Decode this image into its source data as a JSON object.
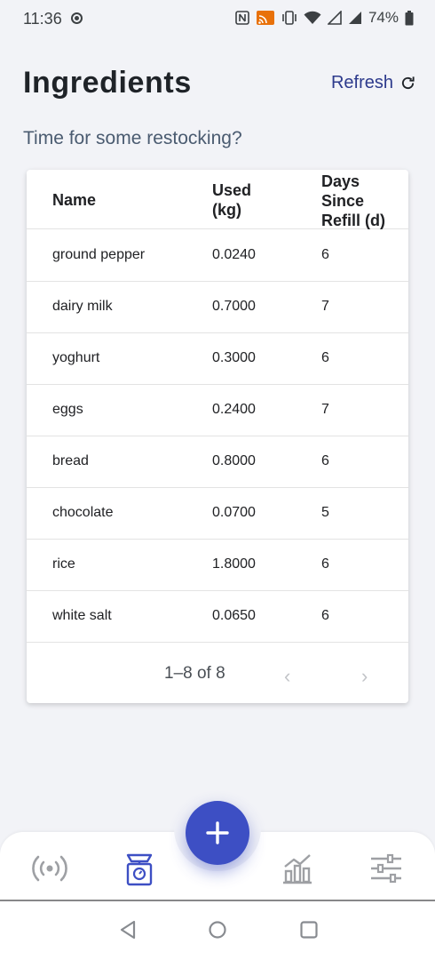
{
  "status_bar": {
    "time": "11:36",
    "battery": "74%",
    "icons": [
      "recording-icon",
      "nfc-icon",
      "cast-icon",
      "vibrate-icon",
      "wifi-icon",
      "signal-icon",
      "signal-icon",
      "battery-icon"
    ]
  },
  "header": {
    "title": "Ingredients",
    "refresh_label": "Refresh"
  },
  "subtitle": "Time for some restocking?",
  "table": {
    "columns": [
      {
        "label": "Name"
      },
      {
        "label": "Used (kg)"
      },
      {
        "label": "Days Since Refill (d)"
      }
    ],
    "rows": [
      {
        "name": "ground pepper",
        "used": "0.0240",
        "days": "6"
      },
      {
        "name": "dairy milk",
        "used": "0.7000",
        "days": "7"
      },
      {
        "name": "yoghurt",
        "used": "0.3000",
        "days": "6"
      },
      {
        "name": "eggs",
        "used": "0.2400",
        "days": "7"
      },
      {
        "name": "bread",
        "used": "0.8000",
        "days": "6"
      },
      {
        "name": "chocolate",
        "used": "0.0700",
        "days": "5"
      },
      {
        "name": "rice",
        "used": "1.8000",
        "days": "6"
      },
      {
        "name": "white salt",
        "used": "0.0650",
        "days": "6"
      }
    ],
    "pagination": "1–8 of 8"
  },
  "bottom_nav": {
    "items": [
      "sensor-icon",
      "scale-icon",
      "chart-icon",
      "sliders-icon"
    ],
    "active": "scale-icon",
    "fab_icon": "plus-icon"
  },
  "colors": {
    "accent": "#3d4fc4",
    "link": "#2d3a8c",
    "background": "#f2f3f7"
  }
}
